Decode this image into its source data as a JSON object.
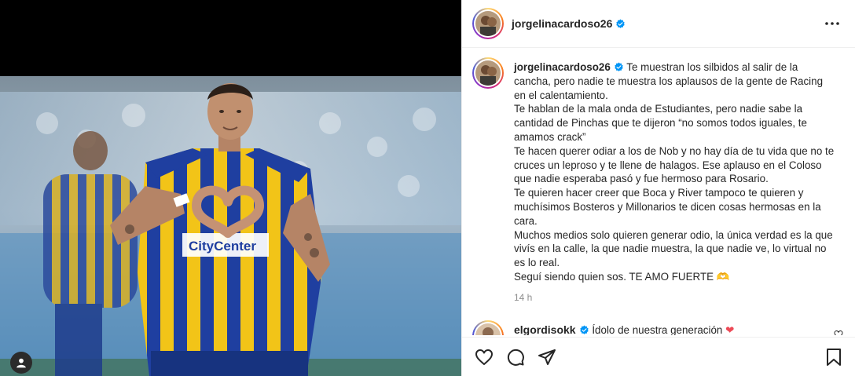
{
  "post": {
    "author": "jorgelinacardoso26",
    "caption_paragraphs": [
      "Te muestran los silbidos al salir de la cancha, pero nadie te muestra los aplausos de la gente de Racing en el calentamiento.",
      "Te hablan de la mala onda de Estudiantes, pero nadie sabe la cantidad de Pinchas que te dijeron “no somos todos iguales, te amamos crack”",
      "Te hacen querer odiar a los de Nob y no hay día de tu vida que no te cruces un leproso y te llene de halagos. Ese aplauso en el Coloso que nadie esperaba pasó y fue hermoso para Rosario.",
      "Te quieren hacer creer que Boca y River tampoco te quieren y muchísimos Bosteros y Millonarios te dicen cosas hermosas en la cara.",
      "Muchos medios solo quieren generar odio, la única verdad es la que vivís en la calle, la que nadie muestra, la que nadie ve, lo virtual no es lo real.",
      "Seguí siendo quien sos. TE AMO FUERTE 🫶"
    ],
    "time_ago": "14 h",
    "image_sponsor_text": "CityCenter"
  },
  "comment": {
    "author": "elgordisokk",
    "text": "Ídolo de nuestra generación",
    "emoji": "❤"
  },
  "colors": {
    "verified": "#0095f6",
    "heart": "#ed4956",
    "jersey_yellow": "#f2c418",
    "jersey_blue": "#1f3fa0"
  },
  "icons": [
    "verified-badge-icon",
    "more-options-icon",
    "like-icon",
    "comment-icon",
    "share-icon",
    "save-icon",
    "user-tag-icon",
    "heart-small-icon"
  ]
}
